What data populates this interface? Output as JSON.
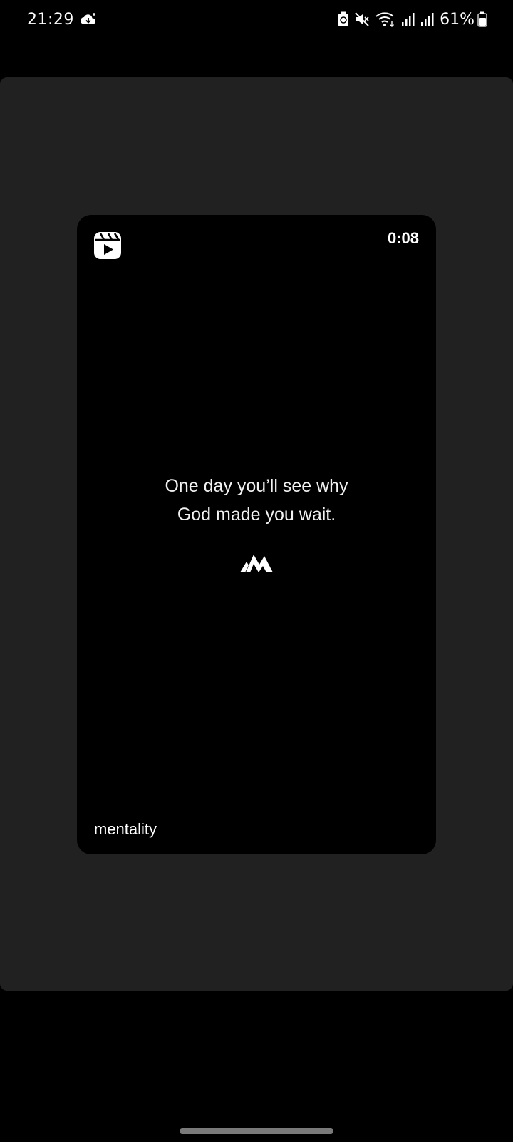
{
  "status_bar": {
    "time": "21:29",
    "battery_percent": "61%",
    "icons": [
      "cloud-download-icon",
      "battery-saver-icon",
      "mute-icon",
      "wifi-icon",
      "signal-icon",
      "signal-icon",
      "battery-icon"
    ]
  },
  "reel": {
    "duration": "0:08",
    "quote_line_1": "One day you’ll see why",
    "quote_line_2": "God made you wait.",
    "username": "mentality",
    "icon": "reels-icon",
    "logo": "mentality-logo"
  },
  "colors": {
    "panel_bg": "#212121",
    "card_bg": "#000000",
    "page_bg": "#000000",
    "text": "#ffffff"
  }
}
